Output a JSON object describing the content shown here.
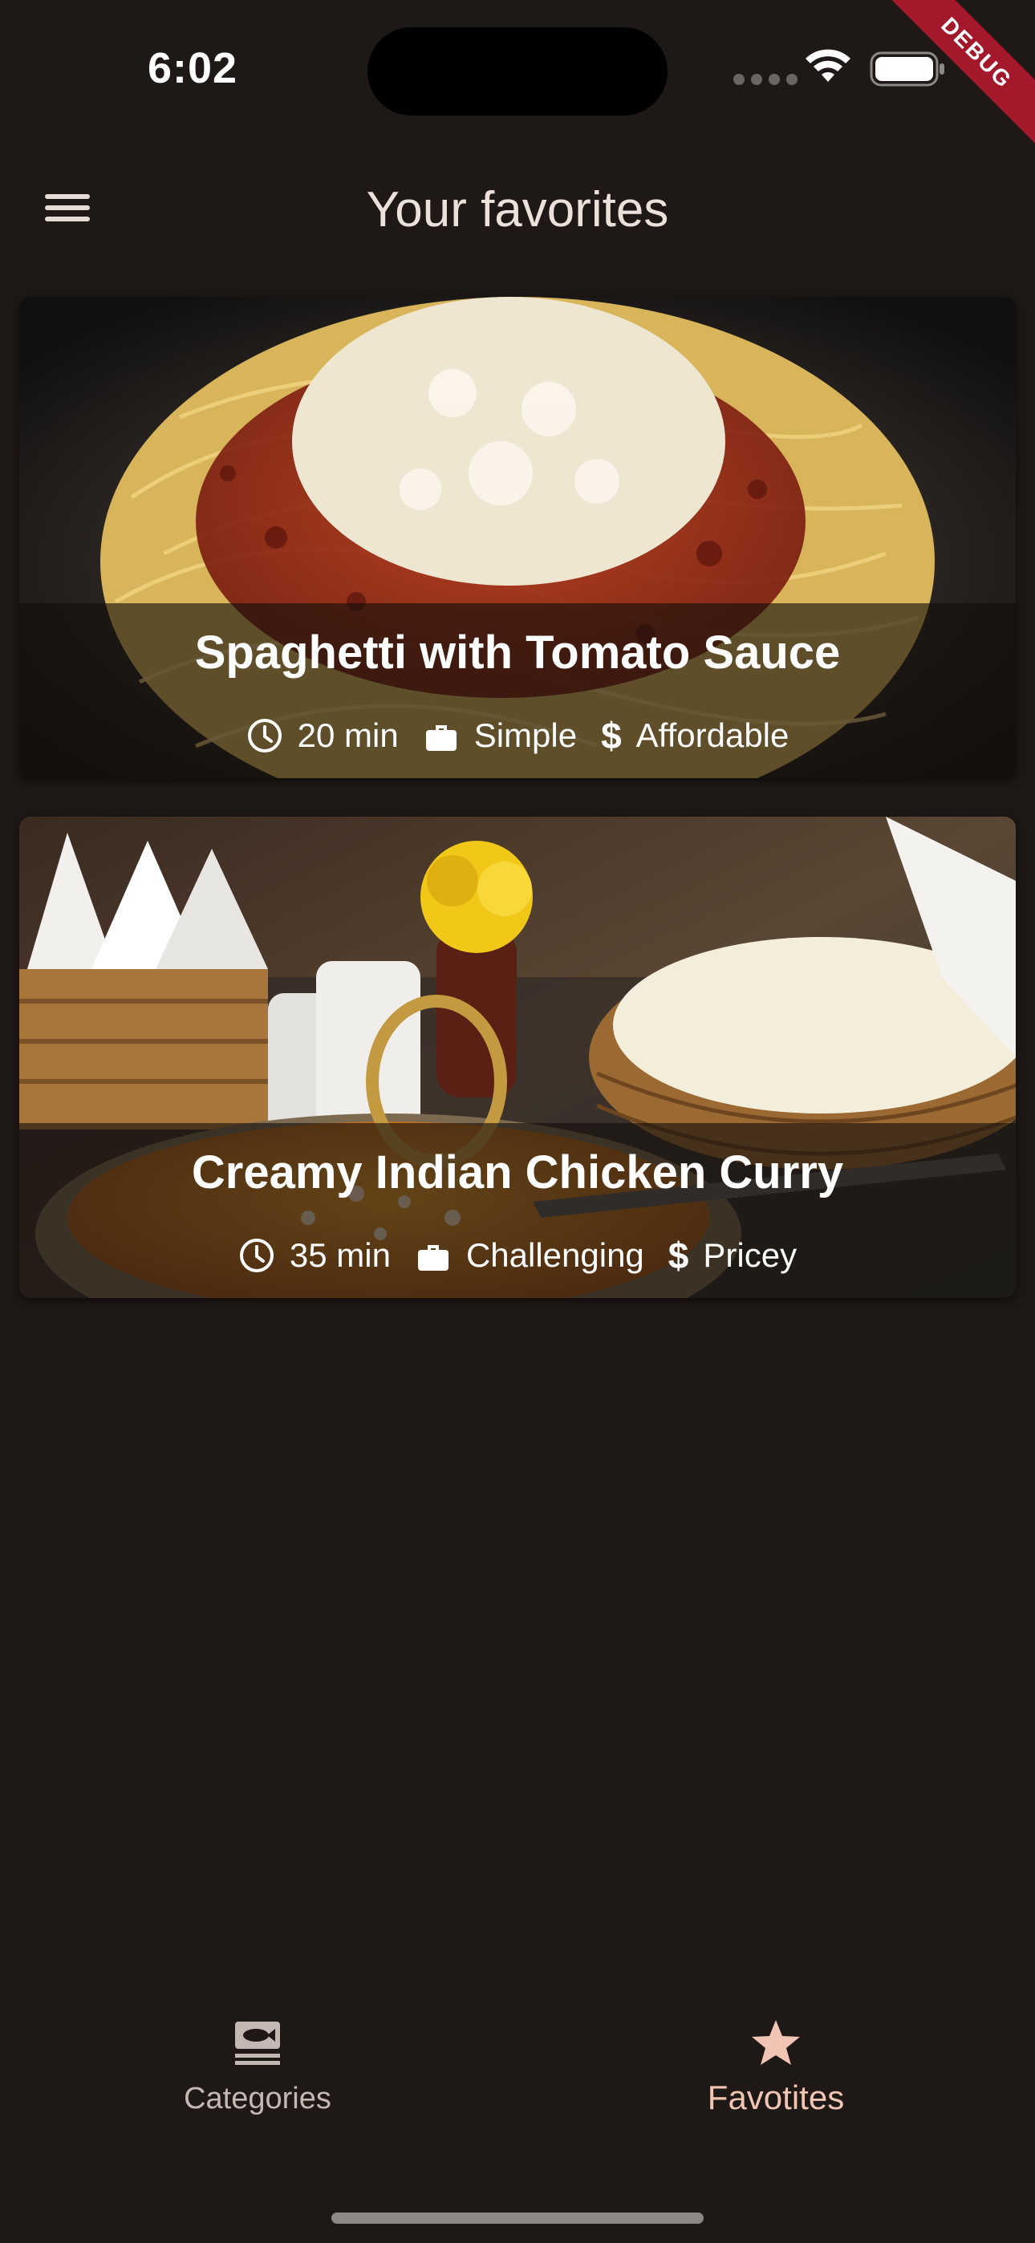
{
  "status_bar": {
    "time": "6:02",
    "debug_label": "DEBUG"
  },
  "app_bar": {
    "title": "Your favorites",
    "menu_icon": "menu-icon"
  },
  "meals": [
    {
      "title": "Spaghetti with Tomato Sauce",
      "duration": "20 min",
      "complexity": "Simple",
      "affordability": "Affordable",
      "image": "spaghetti-photo"
    },
    {
      "title": "Creamy Indian Chicken Curry",
      "duration": "35 min",
      "complexity": "Challenging",
      "affordability": "Pricey",
      "image": "curry-photo"
    }
  ],
  "bottom_nav": {
    "items": [
      {
        "label": "Categories",
        "icon": "set-meal-icon",
        "selected": false
      },
      {
        "label": "Favotites",
        "icon": "star-icon",
        "selected": true
      }
    ]
  },
  "colors": {
    "background": "#1e1816",
    "accent": "#f1c4b4",
    "debug_banner": "#a3192b"
  }
}
